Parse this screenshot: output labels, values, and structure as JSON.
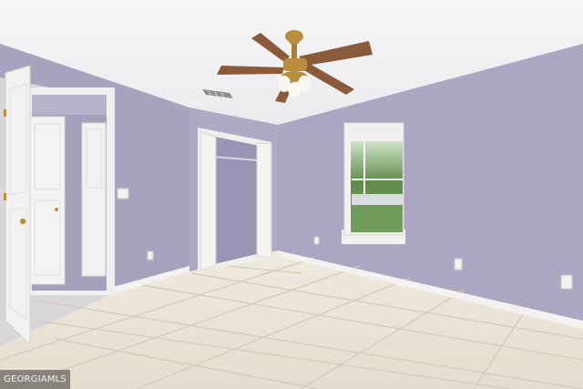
{
  "watermark": {
    "text": "GEORGIAMLS"
  },
  "colors": {
    "ceiling": "#f2f1f2",
    "wall_left": "#a9a3c0",
    "wall_back": "#b1abc6",
    "wall_right": "#aea8c3",
    "floor": "#ebe3d6",
    "grout": "#cfc5b6",
    "trim": "#f4f3f2",
    "fan_blade": "#8a5a3a",
    "fan_brass": "#b98d3e"
  },
  "scene": {
    "objects": [
      "ceiling-fan-icon",
      "air-vent-icon",
      "window",
      "closet",
      "doorway",
      "light-switch-icon",
      "outlet-icon"
    ]
  }
}
